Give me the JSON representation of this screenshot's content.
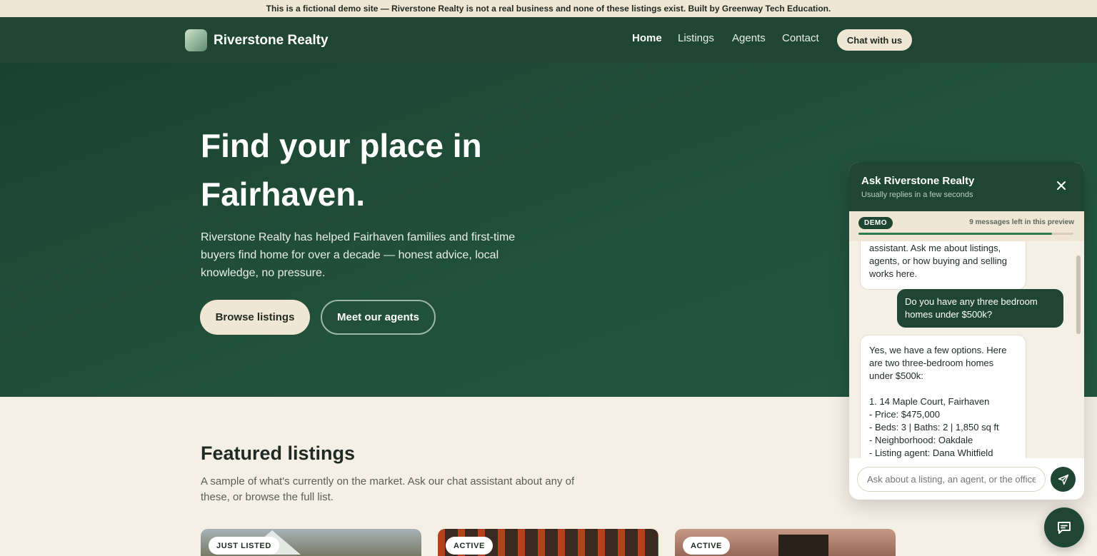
{
  "banner": {
    "text": "This is a fictional demo site — Riverstone Realty is not a real business and none of these listings exist. Built by Greenway Tech Education."
  },
  "nav": {
    "brand": "Riverstone Realty",
    "links": [
      "Home",
      "Listings",
      "Agents",
      "Contact"
    ],
    "active_link": "Home",
    "cta": "Chat with us"
  },
  "hero": {
    "title": "Find your place in Fairhaven.",
    "subtitle": "Riverstone Realty has helped Fairhaven families and first-time buyers find home for over a decade — honest advice, local knowledge, no pressure.",
    "primary_button": "Browse listings",
    "secondary_button": "Meet our agents"
  },
  "featured": {
    "title": "Featured listings",
    "subtitle": "A sample of what's currently on the market. Ask our chat assistant about any of these, or browse the full list.",
    "cards": [
      {
        "badge": "JUST LISTED"
      },
      {
        "badge": "ACTIVE"
      },
      {
        "badge": "ACTIVE"
      }
    ]
  },
  "chat": {
    "title": "Ask Riverstone Realty",
    "subtitle": "Usually replies in a few seconds",
    "close_icon": "close-icon",
    "demo_badge": "DEMO",
    "messages_left": "9 messages left in this preview",
    "messages_left_fraction": 0.9,
    "messages": [
      {
        "role": "assistant",
        "text": "assistant. Ask me about listings, agents, or how buying and selling works here."
      },
      {
        "role": "user",
        "text": "Do you have any three bedroom homes under $500k?"
      },
      {
        "role": "assistant",
        "text": "Yes, we have a few options. Here are two three-bedroom homes under $500k:\n\n1. 14 Maple Court, Fairhaven\n- Price: $475,000\n- Beds: 3 | Baths: 2 | 1,850 sq ft\n- Neighborhood: Oakdale\n- Listing agent: Dana Whitfield"
      }
    ],
    "input_placeholder": "Ask about a listing, an agent, or the office",
    "send_icon": "send-icon"
  },
  "fab": {
    "icon": "chat-bubble-icon"
  },
  "colors": {
    "brand_green": "#1e4633",
    "cream": "#f0e6d4",
    "page_bg": "#f5f0e6"
  }
}
